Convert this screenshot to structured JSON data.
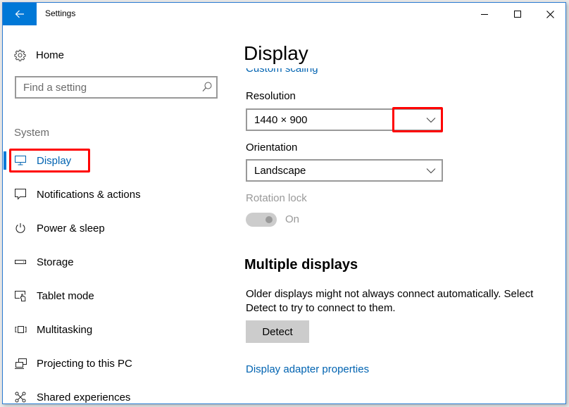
{
  "window": {
    "title": "Settings",
    "controls": {
      "minimize": "minimize",
      "maximize": "maximize",
      "close": "close"
    }
  },
  "sidebar": {
    "home_label": "Home",
    "search": {
      "placeholder": "Find a setting",
      "value": ""
    },
    "section_label": "System",
    "items": [
      {
        "label": "Display",
        "icon": "monitor-icon",
        "active": true
      },
      {
        "label": "Notifications & actions",
        "icon": "notification-icon",
        "active": false
      },
      {
        "label": "Power & sleep",
        "icon": "power-icon",
        "active": false
      },
      {
        "label": "Storage",
        "icon": "storage-icon",
        "active": false
      },
      {
        "label": "Tablet mode",
        "icon": "tablet-mode-icon",
        "active": false
      },
      {
        "label": "Multitasking",
        "icon": "multitasking-icon",
        "active": false
      },
      {
        "label": "Projecting to this PC",
        "icon": "projecting-icon",
        "active": false
      },
      {
        "label": "Shared experiences",
        "icon": "shared-experiences-icon",
        "active": false
      }
    ]
  },
  "main": {
    "page_title": "Display",
    "clipped_link": "Custom scaling",
    "resolution": {
      "label": "Resolution",
      "selected": "1440 × 900"
    },
    "orientation": {
      "label": "Orientation",
      "selected": "Landscape"
    },
    "rotation_lock": {
      "label": "Rotation lock",
      "state_label": "On",
      "enabled": false,
      "on": true
    },
    "multiple_displays": {
      "heading": "Multiple displays",
      "description": "Older displays might not always connect automatically. Select Detect to try to connect to them.",
      "detect_button": "Detect",
      "adapter_link": "Display adapter properties"
    }
  },
  "colors": {
    "accent": "#0078d7",
    "link": "#0063b1",
    "annotation": "#ff0000",
    "disabled_text": "#999999",
    "window_border": "#2b7cd3"
  }
}
